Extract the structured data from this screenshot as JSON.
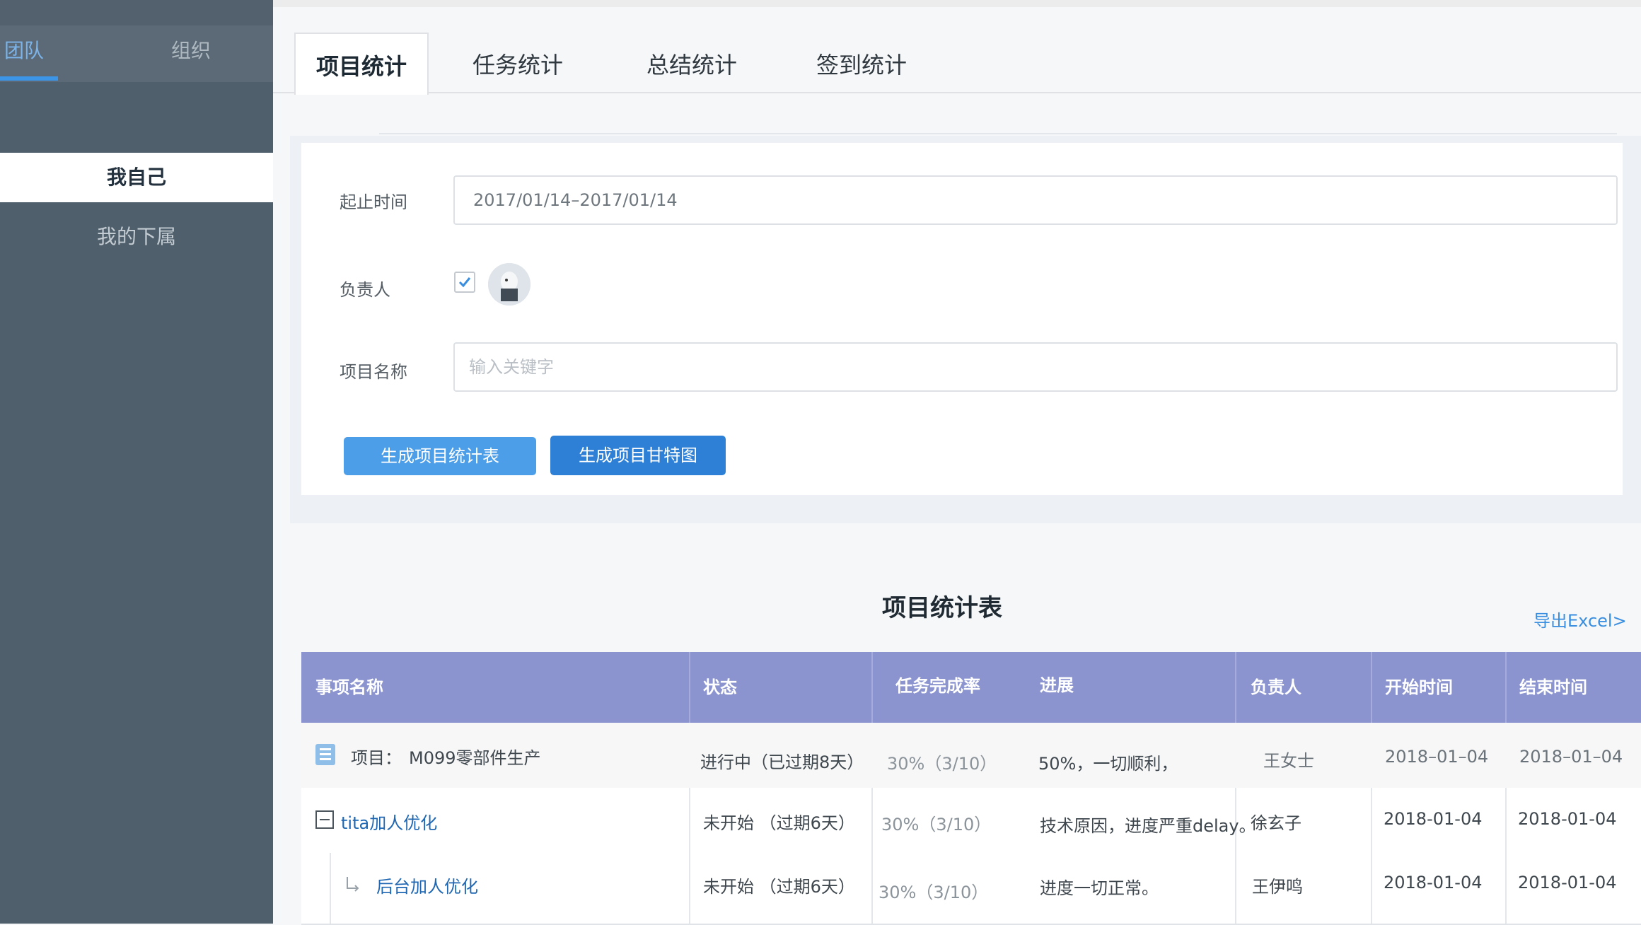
{
  "sidebar": {
    "tabs": [
      {
        "label": "团队"
      },
      {
        "label": "组织"
      }
    ],
    "items": [
      {
        "label": "我自己"
      },
      {
        "label": "我的下属"
      }
    ]
  },
  "tabs": [
    {
      "label": "项目统计"
    },
    {
      "label": "任务统计"
    },
    {
      "label": "总结统计"
    },
    {
      "label": "签到统计"
    }
  ],
  "form": {
    "date_label": "起止时间",
    "date_value": "2017/01/14–2017/01/14",
    "owner_label": "负责人",
    "owner_checked": true,
    "project_label": "项目名称",
    "project_placeholder": "输入关键字",
    "generate_table_label": "生成项目统计表",
    "generate_gantt_label": "生成项目甘特图"
  },
  "report": {
    "title": "项目统计表",
    "export_label": "导出Excel>",
    "columns": [
      "事项名称",
      "状态",
      "任务完成率",
      "进展",
      "负责人",
      "开始时间",
      "结束时间"
    ],
    "rows": [
      {
        "name_prefix": "项目：",
        "name": "M099零部件生产",
        "status": "进行中（已过期8天）",
        "rate": "30%（3/10）",
        "progress": "50%，一切顺利，",
        "owner": "王女士",
        "start": "2018–01–04",
        "end": "2018–01–04"
      },
      {
        "name": "tita加人优化",
        "status": "未开始 （过期6天）",
        "rate": "30%（3/10）",
        "progress": "技术原因，进度严重delay。",
        "owner": "徐玄子",
        "start": "2018-01-04",
        "end": "2018-01-04"
      },
      {
        "name": "后台加人优化",
        "status": "未开始 （过期6天）",
        "rate": "30%（3/10）",
        "progress": "进度一切正常。",
        "owner": "王伊鸣",
        "start": "2018-01-04",
        "end": "2018-01-04"
      }
    ]
  },
  "colors": {
    "sidebar": "#4f5f6b",
    "accent": "#3c95e6",
    "table_header": "#8b94cf",
    "link": "#1f67b3"
  }
}
